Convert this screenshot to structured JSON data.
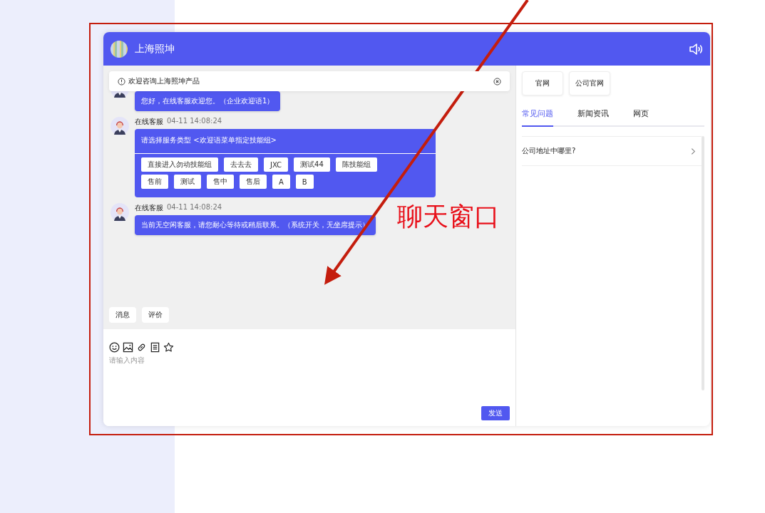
{
  "header": {
    "title": "上海照坤"
  },
  "notice": {
    "text": "欢迎咨询上海照坤产品"
  },
  "messages": [
    {
      "kind": "text",
      "text": "您好，在线客服欢迎您。（企业欢迎语1）"
    },
    {
      "kind": "menu",
      "sender": "在线客服",
      "time": "04-11 14:08:24",
      "text": "请选择服务类型 <欢迎语菜单指定技能组>",
      "options": [
        "直接进入勿动技能组",
        "去去去",
        "JXC",
        "测试44",
        "陈技能组",
        "售前",
        "测试",
        "售中",
        "售后",
        "A",
        "B"
      ]
    },
    {
      "kind": "text",
      "sender": "在线客服",
      "time": "04-11 14:08:24",
      "text": "当前无空闲客服，请您耐心等待或稍后联系。（系统开关，无坐席提示）"
    }
  ],
  "quick_buttons": [
    "消息",
    "评价"
  ],
  "input": {
    "placeholder": "请输入内容"
  },
  "send_button": "发送",
  "links": [
    "官网",
    "公司官网"
  ],
  "tabs": [
    {
      "label": "常见问题",
      "selected": true
    },
    {
      "label": "新闻资讯",
      "selected": false
    },
    {
      "label": "网页",
      "selected": false
    }
  ],
  "faq": [
    "公司地址中哪里?"
  ],
  "annotation": {
    "label": "聊天窗口"
  }
}
